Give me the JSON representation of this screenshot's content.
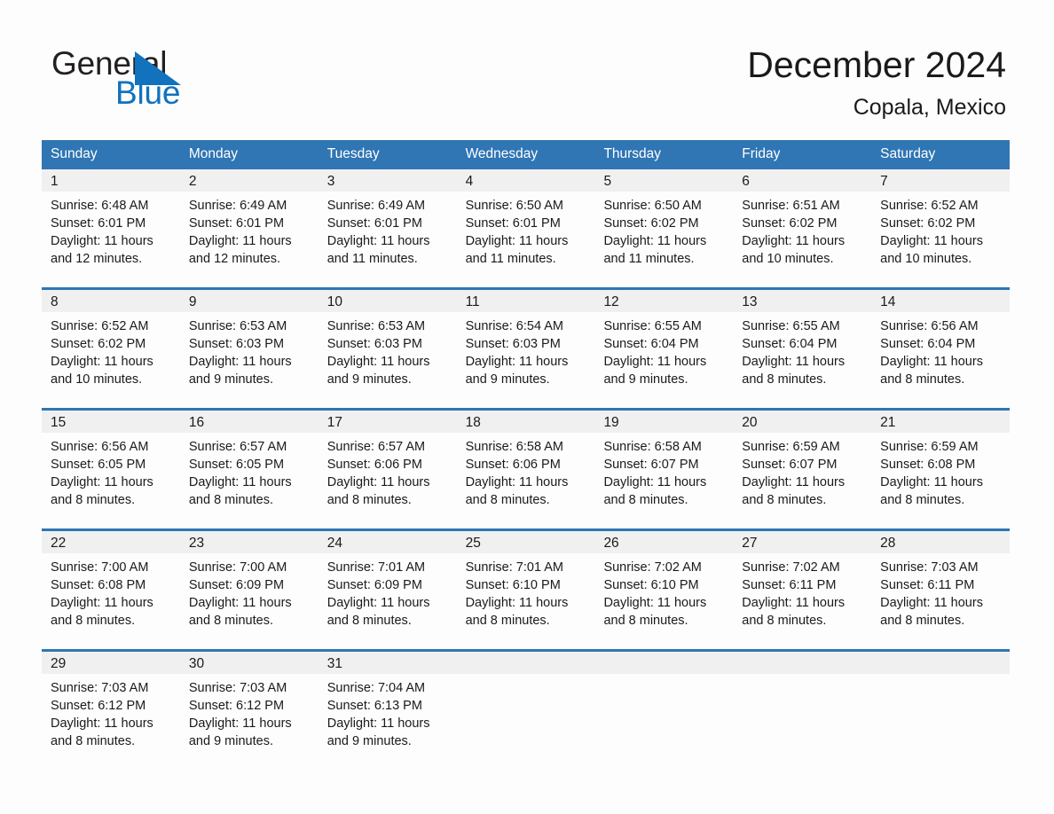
{
  "brand": {
    "name_part1": "General",
    "name_part2": "Blue",
    "accent_color": "#1272bd",
    "triangle_icon": "triangle-icon"
  },
  "header": {
    "title": "December 2024",
    "subtitle": "Copala, Mexico"
  },
  "calendar": {
    "header_bg": "#3075b4",
    "daynum_bg": "#f0f0f0",
    "weekdays": [
      "Sunday",
      "Monday",
      "Tuesday",
      "Wednesday",
      "Thursday",
      "Friday",
      "Saturday"
    ],
    "weeks": [
      [
        {
          "day": "1",
          "sunrise": "Sunrise: 6:48 AM",
          "sunset": "Sunset: 6:01 PM",
          "daylight1": "Daylight: 11 hours",
          "daylight2": "and 12 minutes."
        },
        {
          "day": "2",
          "sunrise": "Sunrise: 6:49 AM",
          "sunset": "Sunset: 6:01 PM",
          "daylight1": "Daylight: 11 hours",
          "daylight2": "and 12 minutes."
        },
        {
          "day": "3",
          "sunrise": "Sunrise: 6:49 AM",
          "sunset": "Sunset: 6:01 PM",
          "daylight1": "Daylight: 11 hours",
          "daylight2": "and 11 minutes."
        },
        {
          "day": "4",
          "sunrise": "Sunrise: 6:50 AM",
          "sunset": "Sunset: 6:01 PM",
          "daylight1": "Daylight: 11 hours",
          "daylight2": "and 11 minutes."
        },
        {
          "day": "5",
          "sunrise": "Sunrise: 6:50 AM",
          "sunset": "Sunset: 6:02 PM",
          "daylight1": "Daylight: 11 hours",
          "daylight2": "and 11 minutes."
        },
        {
          "day": "6",
          "sunrise": "Sunrise: 6:51 AM",
          "sunset": "Sunset: 6:02 PM",
          "daylight1": "Daylight: 11 hours",
          "daylight2": "and 10 minutes."
        },
        {
          "day": "7",
          "sunrise": "Sunrise: 6:52 AM",
          "sunset": "Sunset: 6:02 PM",
          "daylight1": "Daylight: 11 hours",
          "daylight2": "and 10 minutes."
        }
      ],
      [
        {
          "day": "8",
          "sunrise": "Sunrise: 6:52 AM",
          "sunset": "Sunset: 6:02 PM",
          "daylight1": "Daylight: 11 hours",
          "daylight2": "and 10 minutes."
        },
        {
          "day": "9",
          "sunrise": "Sunrise: 6:53 AM",
          "sunset": "Sunset: 6:03 PM",
          "daylight1": "Daylight: 11 hours",
          "daylight2": "and 9 minutes."
        },
        {
          "day": "10",
          "sunrise": "Sunrise: 6:53 AM",
          "sunset": "Sunset: 6:03 PM",
          "daylight1": "Daylight: 11 hours",
          "daylight2": "and 9 minutes."
        },
        {
          "day": "11",
          "sunrise": "Sunrise: 6:54 AM",
          "sunset": "Sunset: 6:03 PM",
          "daylight1": "Daylight: 11 hours",
          "daylight2": "and 9 minutes."
        },
        {
          "day": "12",
          "sunrise": "Sunrise: 6:55 AM",
          "sunset": "Sunset: 6:04 PM",
          "daylight1": "Daylight: 11 hours",
          "daylight2": "and 9 minutes."
        },
        {
          "day": "13",
          "sunrise": "Sunrise: 6:55 AM",
          "sunset": "Sunset: 6:04 PM",
          "daylight1": "Daylight: 11 hours",
          "daylight2": "and 8 minutes."
        },
        {
          "day": "14",
          "sunrise": "Sunrise: 6:56 AM",
          "sunset": "Sunset: 6:04 PM",
          "daylight1": "Daylight: 11 hours",
          "daylight2": "and 8 minutes."
        }
      ],
      [
        {
          "day": "15",
          "sunrise": "Sunrise: 6:56 AM",
          "sunset": "Sunset: 6:05 PM",
          "daylight1": "Daylight: 11 hours",
          "daylight2": "and 8 minutes."
        },
        {
          "day": "16",
          "sunrise": "Sunrise: 6:57 AM",
          "sunset": "Sunset: 6:05 PM",
          "daylight1": "Daylight: 11 hours",
          "daylight2": "and 8 minutes."
        },
        {
          "day": "17",
          "sunrise": "Sunrise: 6:57 AM",
          "sunset": "Sunset: 6:06 PM",
          "daylight1": "Daylight: 11 hours",
          "daylight2": "and 8 minutes."
        },
        {
          "day": "18",
          "sunrise": "Sunrise: 6:58 AM",
          "sunset": "Sunset: 6:06 PM",
          "daylight1": "Daylight: 11 hours",
          "daylight2": "and 8 minutes."
        },
        {
          "day": "19",
          "sunrise": "Sunrise: 6:58 AM",
          "sunset": "Sunset: 6:07 PM",
          "daylight1": "Daylight: 11 hours",
          "daylight2": "and 8 minutes."
        },
        {
          "day": "20",
          "sunrise": "Sunrise: 6:59 AM",
          "sunset": "Sunset: 6:07 PM",
          "daylight1": "Daylight: 11 hours",
          "daylight2": "and 8 minutes."
        },
        {
          "day": "21",
          "sunrise": "Sunrise: 6:59 AM",
          "sunset": "Sunset: 6:08 PM",
          "daylight1": "Daylight: 11 hours",
          "daylight2": "and 8 minutes."
        }
      ],
      [
        {
          "day": "22",
          "sunrise": "Sunrise: 7:00 AM",
          "sunset": "Sunset: 6:08 PM",
          "daylight1": "Daylight: 11 hours",
          "daylight2": "and 8 minutes."
        },
        {
          "day": "23",
          "sunrise": "Sunrise: 7:00 AM",
          "sunset": "Sunset: 6:09 PM",
          "daylight1": "Daylight: 11 hours",
          "daylight2": "and 8 minutes."
        },
        {
          "day": "24",
          "sunrise": "Sunrise: 7:01 AM",
          "sunset": "Sunset: 6:09 PM",
          "daylight1": "Daylight: 11 hours",
          "daylight2": "and 8 minutes."
        },
        {
          "day": "25",
          "sunrise": "Sunrise: 7:01 AM",
          "sunset": "Sunset: 6:10 PM",
          "daylight1": "Daylight: 11 hours",
          "daylight2": "and 8 minutes."
        },
        {
          "day": "26",
          "sunrise": "Sunrise: 7:02 AM",
          "sunset": "Sunset: 6:10 PM",
          "daylight1": "Daylight: 11 hours",
          "daylight2": "and 8 minutes."
        },
        {
          "day": "27",
          "sunrise": "Sunrise: 7:02 AM",
          "sunset": "Sunset: 6:11 PM",
          "daylight1": "Daylight: 11 hours",
          "daylight2": "and 8 minutes."
        },
        {
          "day": "28",
          "sunrise": "Sunrise: 7:03 AM",
          "sunset": "Sunset: 6:11 PM",
          "daylight1": "Daylight: 11 hours",
          "daylight2": "and 8 minutes."
        }
      ],
      [
        {
          "day": "29",
          "sunrise": "Sunrise: 7:03 AM",
          "sunset": "Sunset: 6:12 PM",
          "daylight1": "Daylight: 11 hours",
          "daylight2": "and 8 minutes."
        },
        {
          "day": "30",
          "sunrise": "Sunrise: 7:03 AM",
          "sunset": "Sunset: 6:12 PM",
          "daylight1": "Daylight: 11 hours",
          "daylight2": "and 9 minutes."
        },
        {
          "day": "31",
          "sunrise": "Sunrise: 7:04 AM",
          "sunset": "Sunset: 6:13 PM",
          "daylight1": "Daylight: 11 hours",
          "daylight2": "and 9 minutes."
        },
        {
          "day": "",
          "sunrise": "",
          "sunset": "",
          "daylight1": "",
          "daylight2": ""
        },
        {
          "day": "",
          "sunrise": "",
          "sunset": "",
          "daylight1": "",
          "daylight2": ""
        },
        {
          "day": "",
          "sunrise": "",
          "sunset": "",
          "daylight1": "",
          "daylight2": ""
        },
        {
          "day": "",
          "sunrise": "",
          "sunset": "",
          "daylight1": "",
          "daylight2": ""
        }
      ]
    ]
  }
}
